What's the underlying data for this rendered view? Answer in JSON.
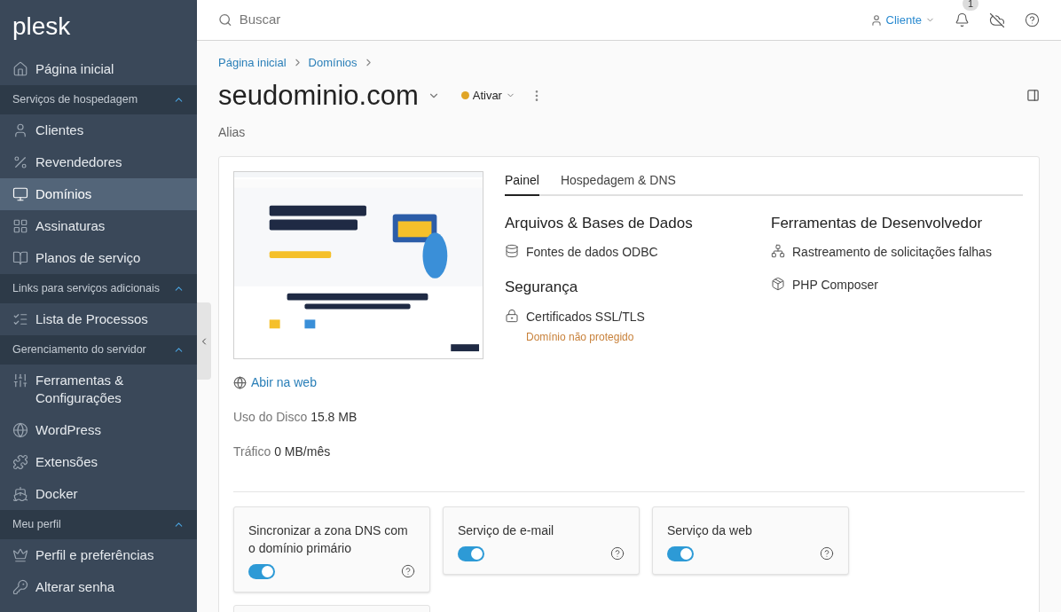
{
  "sidebar": {
    "logo": "plesk",
    "items": [
      {
        "kind": "item",
        "label": "Página inicial",
        "selected": false
      },
      {
        "kind": "section",
        "label": "Serviços de hospedagem",
        "expanded": true
      },
      {
        "kind": "item",
        "label": "Clientes",
        "selected": false
      },
      {
        "kind": "item",
        "label": "Revendedores",
        "selected": false
      },
      {
        "kind": "item",
        "label": "Domínios",
        "selected": true
      },
      {
        "kind": "item",
        "label": "Assinaturas",
        "selected": false
      },
      {
        "kind": "item",
        "label": "Planos de serviço",
        "selected": false
      },
      {
        "kind": "section",
        "label": "Links para serviços adicionais",
        "expanded": true
      },
      {
        "kind": "item",
        "label": "Lista de Processos",
        "selected": false
      },
      {
        "kind": "section",
        "label": "Gerenciamento do servidor",
        "expanded": true
      },
      {
        "kind": "item",
        "label": "Ferramentas & Configurações",
        "selected": false
      },
      {
        "kind": "item",
        "label": "WordPress",
        "selected": false
      },
      {
        "kind": "item",
        "label": "Extensões",
        "selected": false
      },
      {
        "kind": "item",
        "label": "Docker",
        "selected": false
      },
      {
        "kind": "section",
        "label": "Meu perfil",
        "expanded": true
      },
      {
        "kind": "item",
        "label": "Perfil e preferências",
        "selected": false
      },
      {
        "kind": "item",
        "label": "Alterar senha",
        "selected": false
      }
    ]
  },
  "topbar": {
    "search": {
      "placeholder": "Buscar"
    },
    "user": "Cliente",
    "notifications": "1"
  },
  "breadcrumbs": [
    "Página inicial",
    "Domínios"
  ],
  "title": "seudominio.com",
  "status": {
    "label": "Ativar",
    "color": "#e0a526"
  },
  "alias": "Alias",
  "preview": {
    "kind": "picture",
    "link": "Abir na web"
  },
  "stats": [
    {
      "label": "Uso do Disco",
      "value": "15.8 MB"
    },
    {
      "label": "Tráfico",
      "value": "0 MB/mês"
    }
  ],
  "tabs": [
    {
      "label": "Painel",
      "selected": true
    },
    {
      "label": "Hospedagem & DNS",
      "selected": false
    }
  ],
  "groups": [
    {
      "title": "Arquivos & Bases de Dados",
      "items": [
        {
          "label": "Fontes de dados ODBC"
        }
      ]
    },
    {
      "title": "Segurança",
      "items": [
        {
          "label": "Certificados SSL/TLS",
          "note": "Domínio não protegido"
        }
      ]
    },
    {
      "title": "Ferramentas de Desenvolvedor",
      "items": [
        {
          "label": "Rastreamento de solicitações falhas"
        },
        {
          "label": "PHP Composer"
        }
      ]
    }
  ],
  "toggles": [
    {
      "label": "Sincronizar a zona DNS com o domínio primário",
      "on": true
    },
    {
      "label": "Serviço de e-mail",
      "on": true
    },
    {
      "label": "Serviço da web",
      "on": true
    }
  ]
}
